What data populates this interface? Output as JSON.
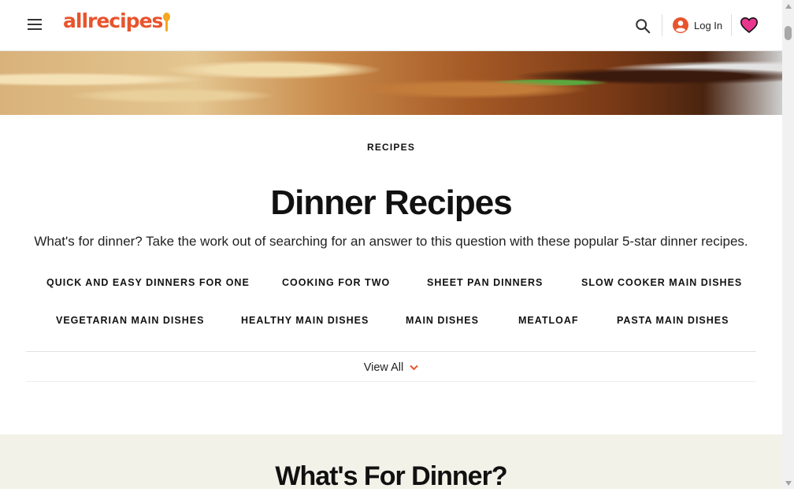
{
  "header": {
    "logo_text": "allrecipes",
    "login_label": "Log In",
    "icons": [
      "hamburger-icon",
      "search-icon",
      "user-icon",
      "heart-icon"
    ],
    "brand_color": "#e8542c",
    "accent_color": "#f6a821"
  },
  "main": {
    "eyebrow": "RECIPES",
    "title": "Dinner Recipes",
    "description": "What's for dinner? Take the work out of searching for an answer to this question with these popular 5-star dinner recipes.",
    "tags": [
      "QUICK AND EASY DINNERS FOR ONE",
      "COOKING FOR TWO",
      "SHEET PAN DINNERS",
      "SLOW COOKER MAIN DISHES",
      "VEGETARIAN MAIN DISHES",
      "HEALTHY MAIN DISHES",
      "MAIN DISHES",
      "MEATLOAF",
      "PASTA MAIN DISHES"
    ],
    "view_all_label": "View All"
  },
  "section": {
    "title": "What's For Dinner?",
    "background_color": "#f2f2e8"
  }
}
